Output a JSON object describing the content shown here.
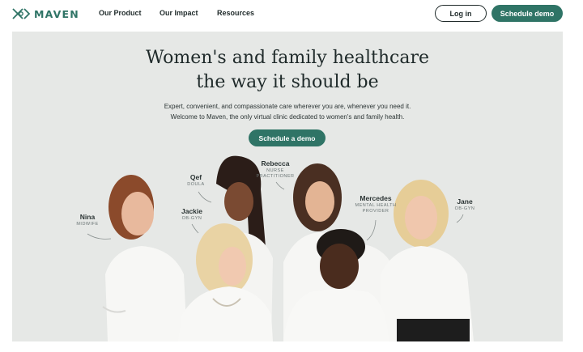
{
  "nav": {
    "logo_text": "MAVEN",
    "links": [
      "Our Product",
      "Our Impact",
      "Resources"
    ],
    "login_label": "Log in",
    "demo_label": "Schedule demo"
  },
  "hero": {
    "headline_line1": "Women's and family healthcare",
    "headline_line2": "the way it should be",
    "sub_line1": "Expert, convenient, and compassionate care wherever you are, whenever you need it.",
    "sub_line2": "Welcome to Maven, the only virtual clinic dedicated to women's and family health.",
    "cta_label": "Schedule a demo"
  },
  "providers": [
    {
      "name": "Nina",
      "role": "MIDWIFE"
    },
    {
      "name": "Qef",
      "role": "DOULA"
    },
    {
      "name": "Jackie",
      "role": "OB-GYN"
    },
    {
      "name": "Rebecca",
      "role": "NURSE PRACTITIONER"
    },
    {
      "name": "Mercedes",
      "role": "MENTAL HEALTH PROVIDER"
    },
    {
      "name": "Jane",
      "role": "OB-GYN"
    }
  ],
  "colors": {
    "brand": "#2f7466",
    "hero_bg": "#e6e8e6",
    "text": "#1f2a2a"
  }
}
